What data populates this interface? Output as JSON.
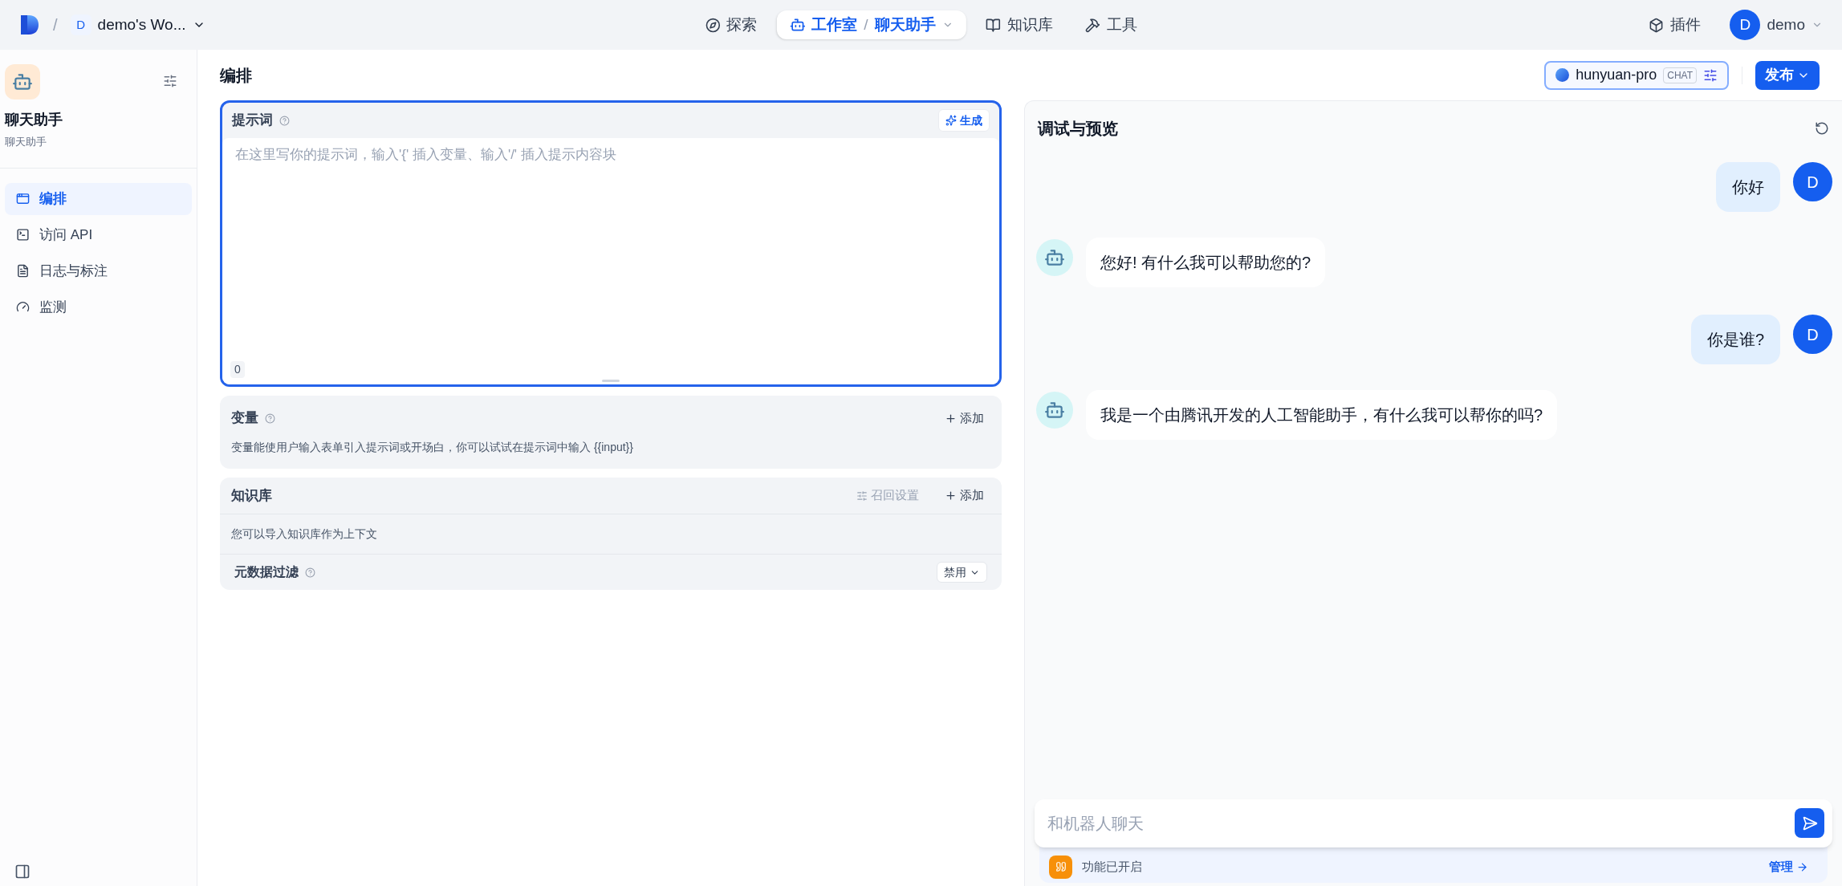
{
  "topbar": {
    "separator": "/",
    "workspace": {
      "initial": "D",
      "name": "demo's Wo..."
    },
    "nav": [
      {
        "kind": "explore",
        "label": "探索",
        "selected": false
      },
      {
        "kind": "studio",
        "label": "工作室",
        "separator": "/",
        "app": "聊天助手",
        "selected": true
      },
      {
        "kind": "knowledge",
        "label": "知识库",
        "selected": false
      },
      {
        "kind": "tools",
        "label": "工具",
        "selected": false
      }
    ],
    "plugins": "插件",
    "user": {
      "initial": "D",
      "name": "demo"
    }
  },
  "sidebar": {
    "app_name": "聊天助手",
    "app_type": "聊天助手",
    "items": [
      {
        "kind": "layout",
        "label": "编排",
        "selected": true
      },
      {
        "kind": "api",
        "label": "访问 API",
        "selected": false
      },
      {
        "kind": "logs",
        "label": "日志与标注",
        "selected": false
      },
      {
        "kind": "monitor",
        "label": "监测",
        "selected": false
      }
    ]
  },
  "header": {
    "title": "编排",
    "model": {
      "name": "hunyuan-pro",
      "tag": "CHAT"
    },
    "publish": "发布"
  },
  "prompt": {
    "title": "提示词",
    "generate": "生成",
    "placeholder": "在这里写你的提示词，输入'{' 插入变量、输入'/' 插入提示内容块",
    "count": "0"
  },
  "variables": {
    "title": "变量",
    "add": "添加",
    "description": "变量能使用户输入表单引入提示词或开场白，你可以试试在提示词中输入 {{input}}"
  },
  "knowledge": {
    "title": "知识库",
    "retrieval": "召回设置",
    "add": "添加",
    "description": "您可以导入知识库作为上下文",
    "filter": {
      "label": "元数据过滤",
      "value": "禁用"
    }
  },
  "chat": {
    "title": "调试与预览",
    "messages": [
      {
        "kind": "user",
        "avatar": "D",
        "text": "你好"
      },
      {
        "kind": "bot",
        "text": "您好! 有什么我可以帮助您的?"
      },
      {
        "kind": "user",
        "avatar": "D",
        "text": "你是谁?"
      },
      {
        "kind": "bot",
        "text": "我是一个由腾讯开发的人工智能助手，有什么我可以帮你的吗?"
      }
    ],
    "input": {
      "placeholder": "和机器人聊天"
    },
    "features": {
      "text": "功能已开启",
      "manage": "管理"
    }
  }
}
